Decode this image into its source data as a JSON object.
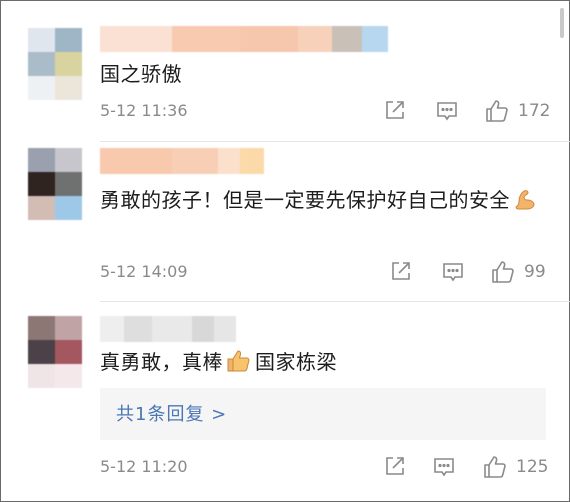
{
  "comments": [
    {
      "username": "",
      "text": "国之骄傲",
      "date": "5-12 11:36",
      "like_count": "172",
      "avatar_colors": [
        "#dfe6ee",
        "#9fb6c7",
        "#a9bcc8",
        "#d9d3a0",
        "#eef1f4",
        "#ece6da"
      ],
      "name_colors": [
        "#fbe1d4",
        "#f8cbb1",
        "#f6c7ad",
        "#f7d1b9",
        "#c9c0b8",
        "#b7d7f0"
      ]
    },
    {
      "username": "",
      "text": "勇敢的孩子！但是一定要先保护好自己的安全",
      "emoji": "flexed-biceps",
      "date": "5-12 14:09",
      "like_count": "99",
      "avatar_colors": [
        "#9aa0ad",
        "#c6c6cc",
        "#2f2420",
        "#6f7070",
        "#d2bcb4",
        "#9ec8e8"
      ],
      "name_colors": [
        "#f9c9ad",
        "#f8cfb5",
        "#fbe0cc",
        "#fcd9a8"
      ]
    },
    {
      "username": "",
      "text": "真勇敢，真棒",
      "emoji": "thumbs-up",
      "text_after": "国家栋梁",
      "date": "5-12 11:20",
      "like_count": "125",
      "reply_label": "共1条回复 >",
      "avatar_colors": [
        "#8c7775",
        "#bfa3a5",
        "#4a4248",
        "#a5575f",
        "#efe5e6",
        "#f5e8ea"
      ],
      "name_colors": [
        "#eeeeee",
        "#dedede",
        "#e9e9e9",
        "#d8d8d8",
        "#e6e6e6"
      ]
    }
  ],
  "icons": {
    "share": "share-icon",
    "comment": "comment-icon",
    "like": "like-icon"
  }
}
